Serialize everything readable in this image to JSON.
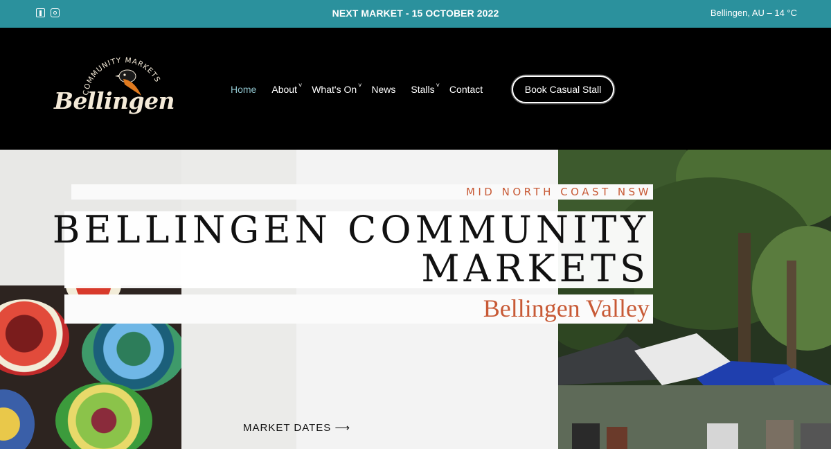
{
  "topbar": {
    "next_market": "NEXT MARKET - 15 OCTOBER 2022",
    "weather": "Bellingen, AU – 14 °C",
    "socials": [
      "facebook-icon",
      "instagram-icon"
    ]
  },
  "logo": {
    "arc_text": "COMMUNITY MARKETS",
    "brand": "Bellingen"
  },
  "nav": {
    "items": [
      {
        "label": "Home",
        "dropdown": false
      },
      {
        "label": "About",
        "dropdown": true
      },
      {
        "label": "What's On",
        "dropdown": true
      },
      {
        "label": "News",
        "dropdown": false
      },
      {
        "label": "Stalls",
        "dropdown": true
      },
      {
        "label": "Contact",
        "dropdown": false
      }
    ],
    "cta": "Book Casual Stall",
    "chevron": "˅"
  },
  "hero": {
    "kicker": "MID NORTH COAST NSW",
    "title_line1": "BELLINGEN COMMUNITY",
    "title_line2": "MARKETS",
    "subtitle": "Bellingen Valley",
    "link": "MARKET DATES ⟶"
  },
  "colors": {
    "topbar": "#2b919d",
    "accent": "#c85a36",
    "nav_active": "#8fc3cc",
    "header_bg": "#000000"
  }
}
